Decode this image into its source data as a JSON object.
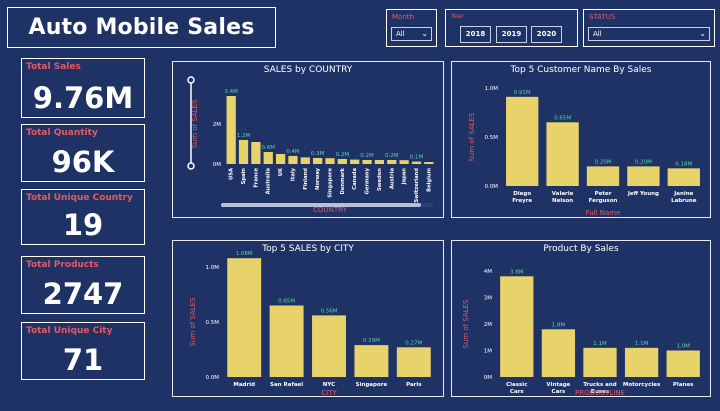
{
  "title": "Auto Mobile Sales",
  "slicers": {
    "month": {
      "label": "Month",
      "value": "All"
    },
    "year": {
      "label": "Year",
      "options": [
        "2018",
        "2019",
        "2020"
      ]
    },
    "status": {
      "label": "STATUS",
      "value": "All"
    }
  },
  "kpis": [
    {
      "label": "Total Sales",
      "value": "9.76M"
    },
    {
      "label": "Total Quantity",
      "value": "96K"
    },
    {
      "label": "Total Unique Country",
      "value": "19"
    },
    {
      "label": "Total Products",
      "value": "2747"
    },
    {
      "label": "Total Unique City",
      "value": "71"
    }
  ],
  "colors": {
    "background": "#1f3266",
    "bar": "#e8d36a",
    "label_red": "#e35a63",
    "data_label": "#5fd3a0"
  },
  "chart_data": [
    {
      "type": "bar",
      "title": "SALES by COUNTRY",
      "xlabel": "COUNTRY",
      "ylabel": "Sum of SALES",
      "yticks": [
        "0M",
        "2M"
      ],
      "ylim": [
        0,
        4
      ],
      "categories": [
        "USA",
        "Spain",
        "France",
        "Australia",
        "UK",
        "Italy",
        "Finland",
        "Norway",
        "Singapore",
        "Denmark",
        "Canada",
        "Germany",
        "Sweden",
        "Austria",
        "Japan",
        "Switzerland",
        "Belgium"
      ],
      "values": [
        3.4,
        1.2,
        1.1,
        0.6,
        0.5,
        0.4,
        0.33,
        0.3,
        0.29,
        0.25,
        0.22,
        0.2,
        0.2,
        0.2,
        0.19,
        0.12,
        0.1
      ],
      "data_labels": [
        "3.4M",
        "1.2M",
        "",
        "0.6M",
        "",
        "0.4M",
        "",
        "0.3M",
        "",
        "0.2M",
        "",
        "0.2M",
        "",
        "0.2M",
        "",
        "0.1M",
        ""
      ]
    },
    {
      "type": "bar",
      "title": "Top 5 Customer Name By Sales",
      "xlabel": "Full Name",
      "ylabel": "Sum of SALES",
      "yticks": [
        "0.0M",
        "0.5M",
        "1.0M"
      ],
      "ylim": [
        0,
        1.0
      ],
      "categories": [
        "Diego Freyre",
        "Valarie Nelson",
        "Peter Ferguson",
        "Jeff Young",
        "Janine Labrune"
      ],
      "values": [
        0.91,
        0.65,
        0.2,
        0.2,
        0.18
      ],
      "data_labels": [
        "0.91M",
        "0.65M",
        "0.20M",
        "0.20M",
        "0.18M"
      ]
    },
    {
      "type": "bar",
      "title": "Top 5 SALES by CITY",
      "xlabel": "CITY",
      "ylabel": "Sum of SALES",
      "yticks": [
        "0.0M",
        "0.5M",
        "1.0M"
      ],
      "ylim": [
        0,
        1.0
      ],
      "categories": [
        "Madrid",
        "San Rafael",
        "NYC",
        "Singapore",
        "Paris"
      ],
      "values": [
        1.08,
        0.65,
        0.56,
        0.29,
        0.27
      ],
      "data_labels": [
        "1.08M",
        "0.65M",
        "0.56M",
        "0.29M",
        "0.27M"
      ]
    },
    {
      "type": "bar",
      "title": "Product By Sales",
      "xlabel": "PRODUCTLINE",
      "ylabel": "Sum of SALES",
      "yticks": [
        "0M",
        "1M",
        "2M",
        "3M",
        "4M"
      ],
      "ylim": [
        0,
        4
      ],
      "categories": [
        "Classic Cars",
        "Vintage Cars",
        "Trucks and Buses",
        "Motorcycles",
        "Planes"
      ],
      "values": [
        3.8,
        1.8,
        1.1,
        1.1,
        1.0
      ],
      "data_labels": [
        "3.8M",
        "1.8M",
        "1.1M",
        "1.1M",
        "1.0M"
      ]
    }
  ]
}
